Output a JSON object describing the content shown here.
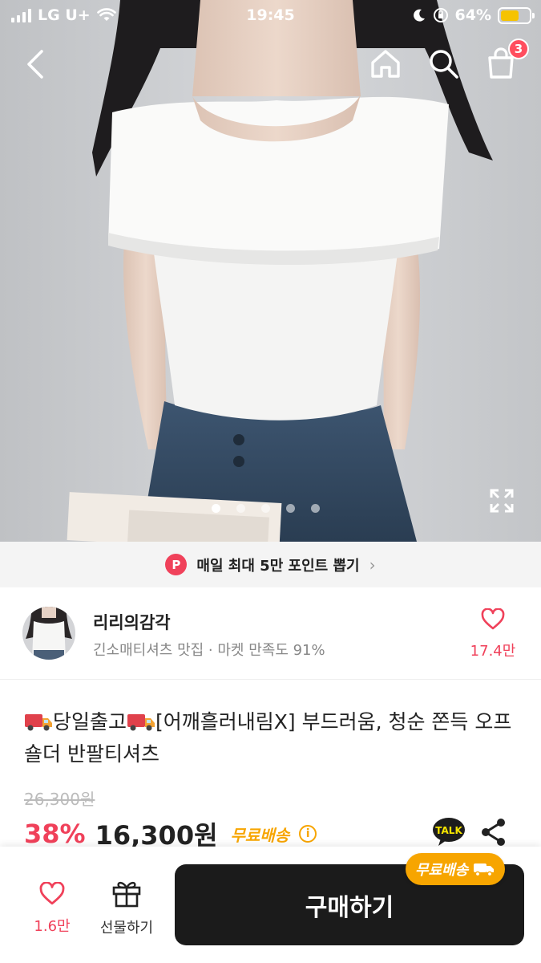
{
  "status_bar": {
    "carrier": "LG U+",
    "time": "19:45",
    "battery": "64%",
    "battery_level": 0.64
  },
  "nav": {
    "cart_count": "3",
    "back_icon": "back-arrow-icon",
    "home_icon": "home-icon",
    "search_icon": "search-icon",
    "cart_icon": "cart-bag-icon"
  },
  "gallery": {
    "total_images": 5,
    "current_index": 0,
    "expand_icon": "expand-icon"
  },
  "points_banner": {
    "badge": "P",
    "text": "매일 최대 5만 포인트 뽑기"
  },
  "shop": {
    "name": "리리의감각",
    "description": "긴소매티셔츠 맛집 · 마켓 만족도 91%",
    "likes": "17.4만"
  },
  "product": {
    "title_part1": "당일출고",
    "title_part2": "[어깨흘러내림X] 부드러움, 청순 쫀득 오프숄더 반팔티셔츠",
    "original_price": "26,300원",
    "discount": "38%",
    "price": "16,300원",
    "shipping": "무료배송",
    "talk_label": "TALK"
  },
  "bottom_bar": {
    "likes": "1.6만",
    "gift_label": "선물하기",
    "buy_label": "구매하기",
    "free_shipping_tag": "무료배송"
  },
  "colors": {
    "accent": "#f0415a",
    "shipping": "#f7a500",
    "buy_button": "#1b1b1b"
  }
}
